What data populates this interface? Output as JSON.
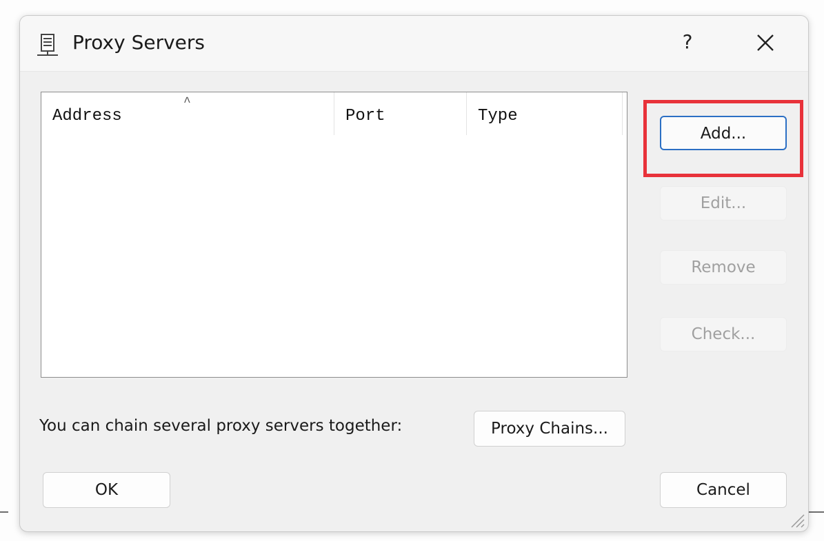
{
  "dialog": {
    "title": "Proxy Servers",
    "icon": "server-icon",
    "help_label": "?",
    "close_icon": "close-icon"
  },
  "list": {
    "columns": [
      {
        "label": "Address",
        "sorted": true
      },
      {
        "label": "Port"
      },
      {
        "label": "Type"
      }
    ],
    "rows": []
  },
  "side_buttons": {
    "add": "Add...",
    "edit": "Edit...",
    "remove": "Remove",
    "check": "Check..."
  },
  "chain": {
    "label": "You can chain several proxy servers together:",
    "button": "Proxy Chains..."
  },
  "footer": {
    "ok": "OK",
    "cancel": "Cancel"
  },
  "colors": {
    "highlight": "#e8323a",
    "focus_border": "#2b6fc4"
  }
}
